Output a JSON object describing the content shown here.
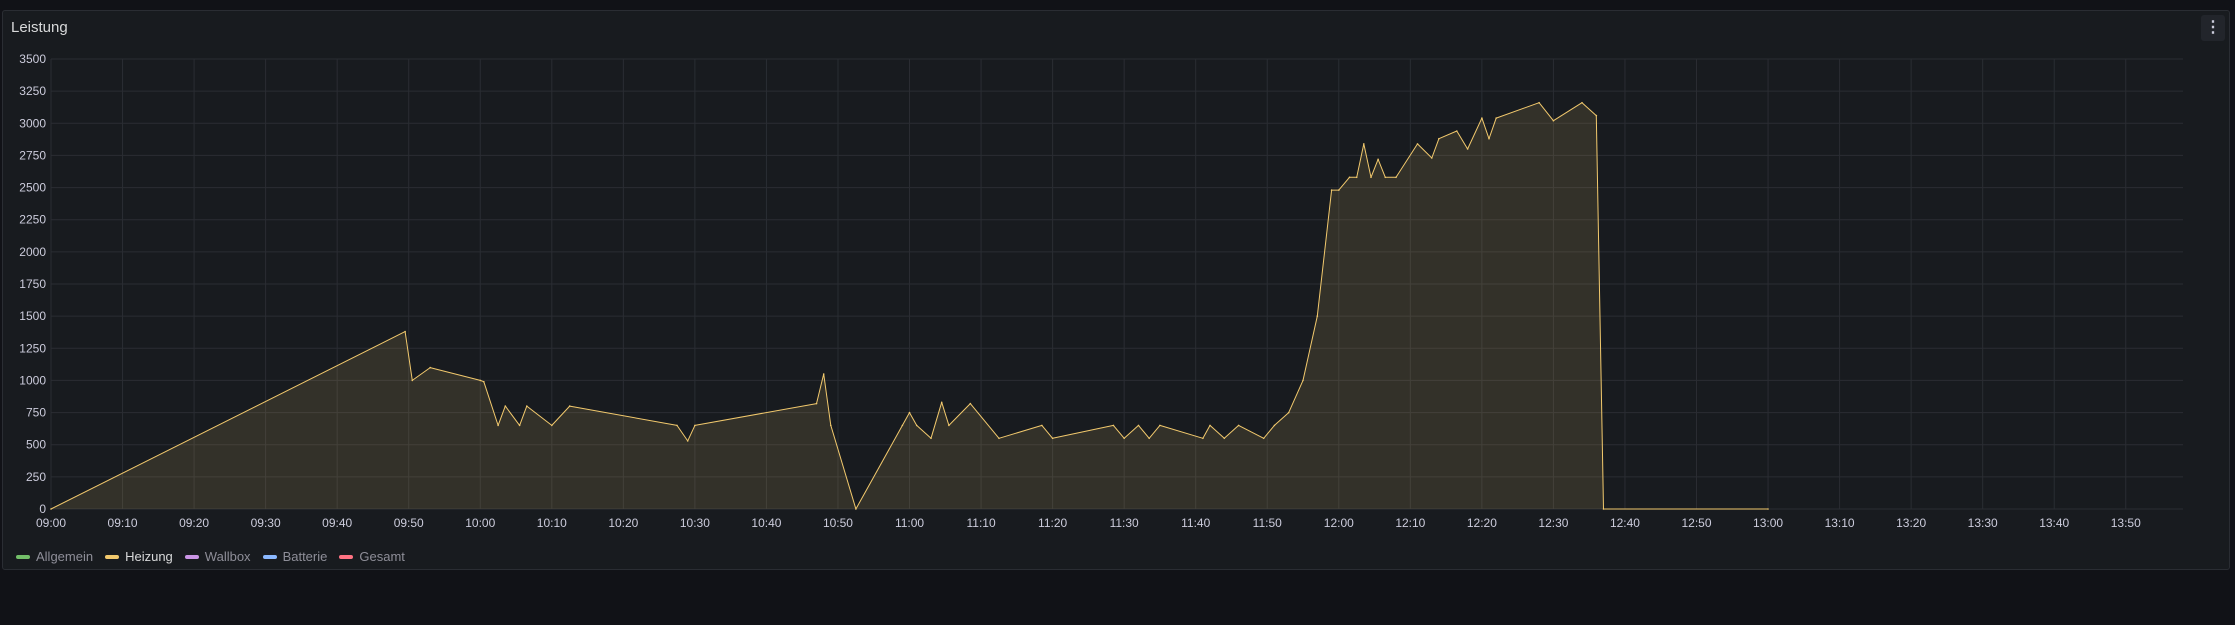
{
  "panel": {
    "title": "Leistung",
    "menu_icon": "⋮"
  },
  "colors": {
    "background": "#111217",
    "panel_bg": "#181b1f",
    "grid": "#2a2d33",
    "heizung": "#f2c96d"
  },
  "legend": [
    {
      "name": "Allgemein",
      "color": "#73bf69",
      "active": false
    },
    {
      "name": "Heizung",
      "color": "#f2c96d",
      "active": true
    },
    {
      "name": "Wallbox",
      "color": "#ca95e5",
      "active": false
    },
    {
      "name": "Batterie",
      "color": "#8ab8ff",
      "active": false
    },
    {
      "name": "Gesamt",
      "color": "#ff7383",
      "active": false
    }
  ],
  "chart_data": {
    "type": "area",
    "title": "Leistung",
    "xlabel": "",
    "ylabel": "",
    "ylim": [
      0,
      3500
    ],
    "xlim": [
      "09:00",
      "13:58"
    ],
    "grid": true,
    "legend_position": "bottom-left",
    "y_ticks": [
      "0",
      "250",
      "500",
      "750",
      "1000",
      "1250",
      "1500",
      "1750",
      "2000",
      "2250",
      "2500",
      "2750",
      "3000",
      "3250",
      "3500"
    ],
    "x_ticks": [
      "09:00",
      "09:10",
      "09:20",
      "09:30",
      "09:40",
      "09:50",
      "10:00",
      "10:10",
      "10:20",
      "10:30",
      "10:40",
      "10:50",
      "11:00",
      "11:10",
      "11:20",
      "11:30",
      "11:40",
      "11:50",
      "12:00",
      "12:10",
      "12:20",
      "12:30",
      "12:40",
      "12:50",
      "13:00",
      "13:10",
      "13:20",
      "13:30",
      "13:40",
      "13:50"
    ],
    "series": [
      {
        "name": "Heizung",
        "color": "#f2c96d",
        "points": [
          [
            "09:00",
            0
          ],
          [
            "09:49.5",
            1380
          ],
          [
            "09:50.5",
            1000
          ],
          [
            "09:53",
            1100
          ],
          [
            "10:00",
            1000
          ],
          [
            "10:00.5",
            990
          ],
          [
            "10:02.5",
            650
          ],
          [
            "10:03.5",
            800
          ],
          [
            "10:05.5",
            650
          ],
          [
            "10:06.5",
            800
          ],
          [
            "10:10",
            650
          ],
          [
            "10:12.5",
            800
          ],
          [
            "10:27.5",
            650
          ],
          [
            "10:29",
            530
          ],
          [
            "10:30",
            650
          ],
          [
            "10:47",
            820
          ],
          [
            "10:48",
            1050
          ],
          [
            "10:49",
            650
          ],
          [
            "10:52.5",
            0
          ],
          [
            "10:59",
            650
          ],
          [
            "11:00",
            750
          ],
          [
            "11:01",
            650
          ],
          [
            "11:03",
            550
          ],
          [
            "11:04.5",
            830
          ],
          [
            "11:05.5",
            650
          ],
          [
            "11:08.5",
            820
          ],
          [
            "11:12.5",
            550
          ],
          [
            "11:18.5",
            650
          ],
          [
            "11:20",
            550
          ],
          [
            "11:28.5",
            650
          ],
          [
            "11:30",
            550
          ],
          [
            "11:32",
            650
          ],
          [
            "11:33.5",
            550
          ],
          [
            "11:35",
            650
          ],
          [
            "11:41",
            550
          ],
          [
            "11:42",
            650
          ],
          [
            "11:44",
            550
          ],
          [
            "11:46",
            650
          ],
          [
            "11:49.5",
            550
          ],
          [
            "11:51",
            650
          ],
          [
            "11:53",
            750
          ],
          [
            "11:55",
            1000
          ],
          [
            "11:57",
            1500
          ],
          [
            "11:59",
            2480
          ],
          [
            "12:00",
            2480
          ],
          [
            "12:01.5",
            2580
          ],
          [
            "12:02.5",
            2580
          ],
          [
            "12:03.5",
            2840
          ],
          [
            "12:04.5",
            2580
          ],
          [
            "12:05.5",
            2720
          ],
          [
            "12:06.5",
            2580
          ],
          [
            "12:08",
            2580
          ],
          [
            "12:11",
            2840
          ],
          [
            "12:13",
            2730
          ],
          [
            "12:14",
            2880
          ],
          [
            "12:16.5",
            2940
          ],
          [
            "12:18",
            2800
          ],
          [
            "12:20",
            3040
          ],
          [
            "12:21",
            2880
          ],
          [
            "12:22",
            3040
          ],
          [
            "12:28",
            3160
          ],
          [
            "12:30",
            3020
          ],
          [
            "12:34",
            3160
          ],
          [
            "12:36",
            3060
          ],
          [
            "12:37",
            0
          ],
          [
            "13:00",
            0
          ]
        ]
      }
    ]
  }
}
